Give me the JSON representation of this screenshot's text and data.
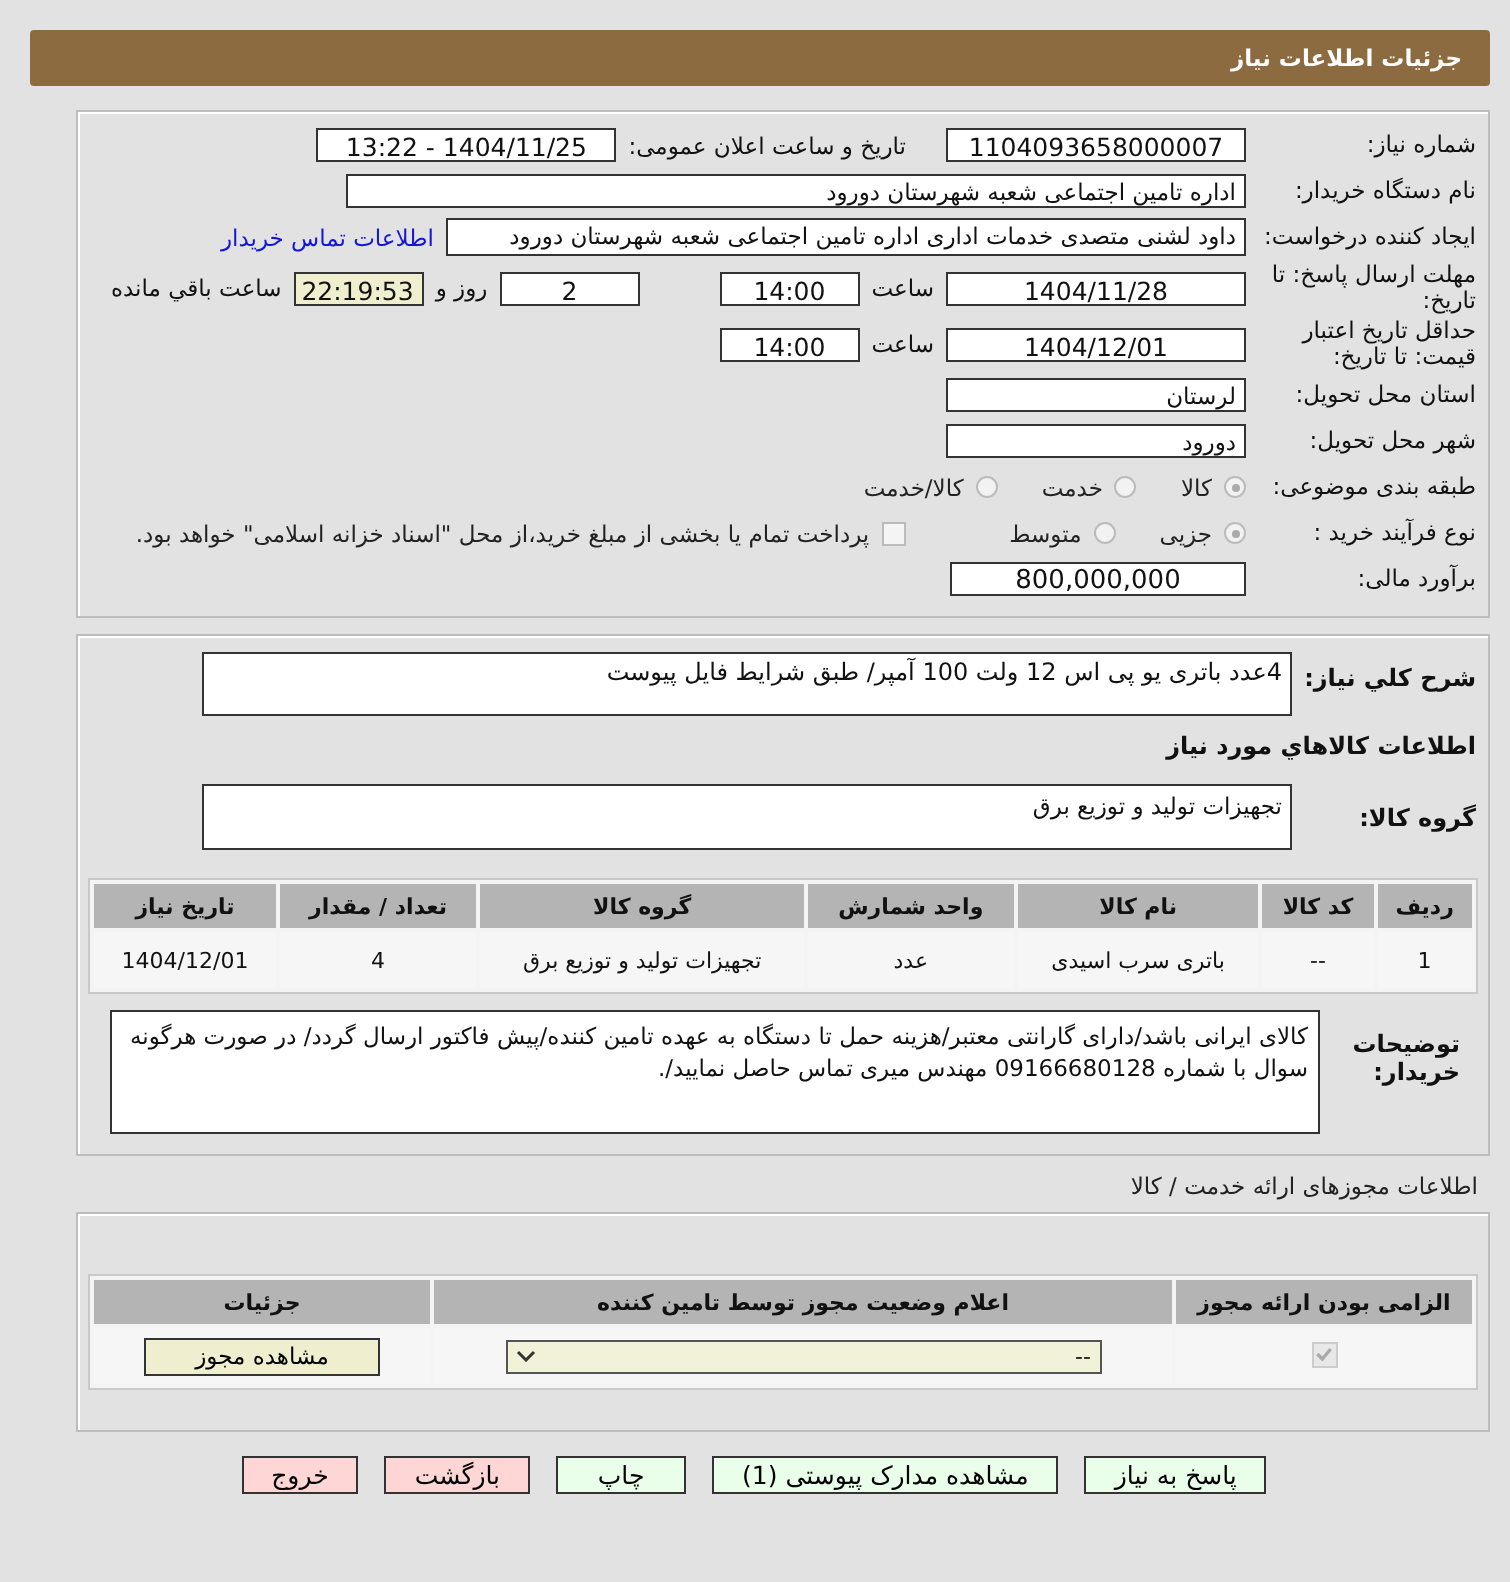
{
  "page_title": "جزئیات اطلاعات نیاز",
  "need_number": {
    "label": "شماره نیاز:",
    "value": "1104093658000007"
  },
  "announce_datetime": {
    "label": "تاریخ و ساعت اعلان عمومی:",
    "value": "1404/11/25 - 13:22"
  },
  "buyer_org": {
    "label": "نام دستگاه خریدار:",
    "value": "اداره تامین اجتماعی شعبه شهرستان دورود"
  },
  "requester": {
    "label": "ایجاد کننده درخواست:",
    "value": "داود لشنی متصدی خدمات اداری اداره تامین اجتماعی شعبه شهرستان دورود",
    "contact_link": "اطلاعات تماس خریدار"
  },
  "reply_deadline": {
    "label": "مهلت ارسال پاسخ: تا تاریخ:",
    "date": "1404/11/28",
    "time_label": "ساعت",
    "time": "14:00",
    "days": "2",
    "days_label": "روز و",
    "remaining": "22:19:53",
    "remaining_label": "ساعت باقي مانده"
  },
  "price_validity": {
    "label": "حداقل تاریخ اعتبار قیمت: تا تاریخ:",
    "date": "1404/12/01",
    "time_label": "ساعت",
    "time": "14:00"
  },
  "province": {
    "label": "استان محل تحویل:",
    "value": "لرستان"
  },
  "city": {
    "label": "شهر محل تحویل:",
    "value": "دورود"
  },
  "category": {
    "label": "طبقه بندی موضوعی:",
    "options": [
      {
        "label": "کالا",
        "selected": true
      },
      {
        "label": "خدمت",
        "selected": false
      },
      {
        "label": "کالا/خدمت",
        "selected": false
      }
    ]
  },
  "purchase_process": {
    "label": "نوع فرآیند خرید :",
    "options": [
      {
        "label": "جزیی",
        "selected": true
      },
      {
        "label": "متوسط",
        "selected": false
      }
    ],
    "payment_note": {
      "label": "پرداخت تمام یا بخشی از مبلغ خرید،از محل \"اسناد خزانه اسلامی\" خواهد بود.",
      "checked": false
    }
  },
  "budget": {
    "label": "برآورد مالی:",
    "value": "800,000,000"
  },
  "description": {
    "label": "شرح کلي نياز:",
    "value": "4عدد باتری یو پی اس 12 ولت 100 آمپر/ طبق شرایط فایل پیوست"
  },
  "goods_title": "اطلاعات کالاهاي مورد نياز",
  "goods_group": {
    "label": "گروه کالا:",
    "value": "تجهیزات تولید و توزیع برق"
  },
  "goods_table": {
    "columns": [
      "ردیف",
      "کد کالا",
      "نام کالا",
      "واحد شمارش",
      "گروه کالا",
      "تعداد / مقدار",
      "تاریخ نیاز"
    ],
    "rows": [
      [
        "1",
        "--",
        "باتری سرب اسیدی",
        "عدد",
        "تجهیزات تولید و توزیع برق",
        "4",
        "1404/12/01"
      ]
    ]
  },
  "buyer_notes": {
    "label": "توضیحات خریدار:",
    "value": "کالای ایرانی باشد/دارای گارانتی معتبر/هزینه حمل تا دستگاه به عهده تامین کننده/پیش فاکتور ارسال گردد/ در صورت هرگونه سوال با شماره 09166680128 مهندس میری تماس حاصل نمایید/."
  },
  "permits_title": "اطلاعات مجوزهای ارائه خدمت / کالا",
  "permits_table": {
    "columns": [
      "الزامی بودن ارائه مجوز",
      "اعلام وضعیت مجوز توسط تامین کننده",
      "جزئیات"
    ],
    "rows": [
      {
        "required": true,
        "status": "--",
        "details_button": "مشاهده مجوز"
      }
    ]
  },
  "buttons": [
    {
      "label": "پاسخ به نیاز",
      "kind": "green"
    },
    {
      "label": "مشاهده مدارک پیوستی (1)",
      "kind": "green"
    },
    {
      "label": "چاپ",
      "kind": "green"
    },
    {
      "label": "بازگشت",
      "kind": "red"
    },
    {
      "label": "خروج",
      "kind": "red"
    }
  ]
}
